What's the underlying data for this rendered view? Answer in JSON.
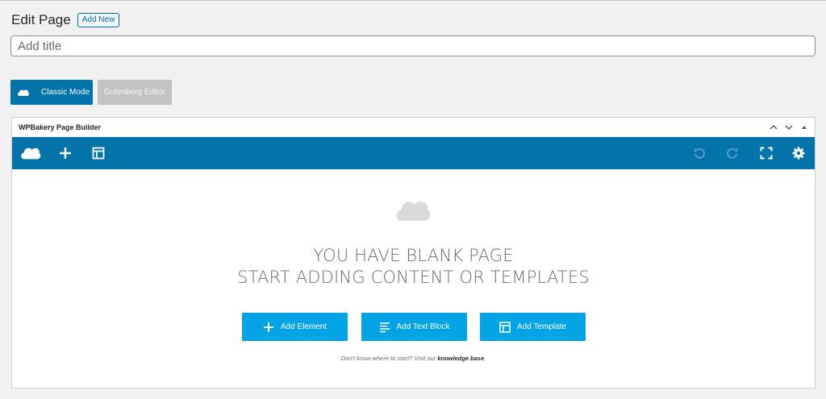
{
  "header": {
    "title": "Edit Page",
    "add_new_label": "Add New"
  },
  "title_field": {
    "placeholder": "Add title",
    "value": ""
  },
  "modes": {
    "classic_label": "Classic Mode",
    "gutenberg_label": "Gutenberg Editor"
  },
  "builder": {
    "title": "WPBakery Page Builder",
    "toolbar_icons": [
      "logo-cloud-icon",
      "plus-icon",
      "layout-icon",
      "undo-icon",
      "redo-icon",
      "fullscreen-icon",
      "gear-icon"
    ],
    "empty": {
      "line1": "YOU HAVE BLANK PAGE",
      "line2": "START ADDING CONTENT OR TEMPLATES",
      "buttons": [
        "Add Element",
        "Add Text Block",
        "Add Template"
      ],
      "help_prefix": "Don't know where to start? Visit our ",
      "help_link": "knowledge base",
      "help_suffix": "."
    }
  },
  "colors": {
    "wp_blue": "#0073aa",
    "toolbar": "#0473aa",
    "action": "#02a4e6",
    "disabled": "#c2c2c2"
  }
}
